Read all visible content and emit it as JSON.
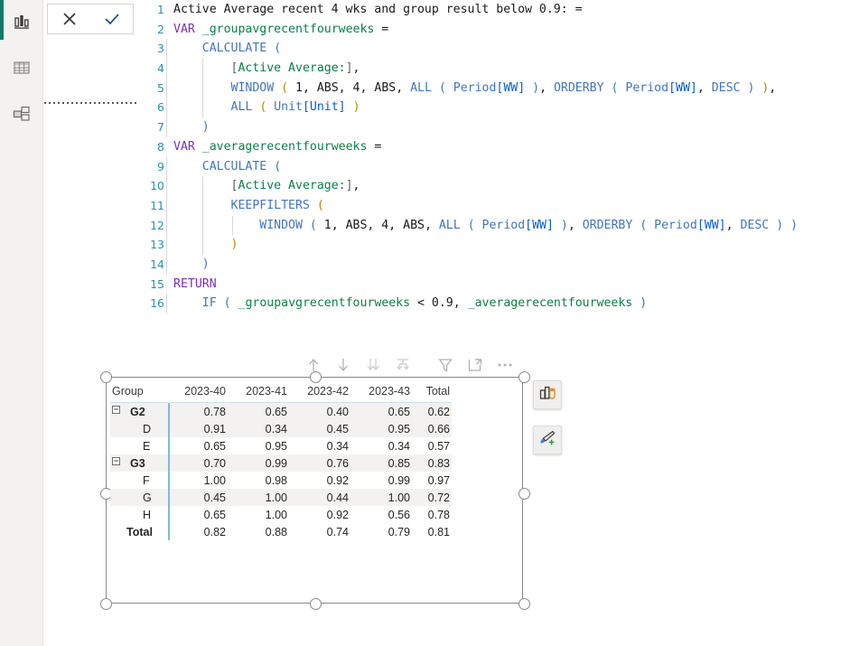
{
  "app": {
    "sidebar": {
      "items": [
        {
          "name": "report-view",
          "icon": "bar-chart-icon",
          "selected": true
        },
        {
          "name": "data-view",
          "icon": "table-grid-icon",
          "selected": false
        },
        {
          "name": "model-view",
          "icon": "relationships-icon",
          "selected": false
        }
      ],
      "accent_color": "#0f7a6b"
    },
    "formula_bar": {
      "cancel_label": "✕",
      "commit_label": "✓",
      "cancel_name": "cancel-edit-button",
      "commit_name": "commit-edit-button"
    }
  },
  "editor": {
    "language": "DAX",
    "line_count": 16,
    "lines": [
      {
        "n": "1",
        "indent": 0,
        "tokens": [
          {
            "t": "Active Average recent 4 wks and group result below 0.9: =",
            "c": "t-plain"
          }
        ]
      },
      {
        "n": "2",
        "indent": 0,
        "tokens": [
          {
            "t": "VAR",
            "c": "t-kw"
          },
          {
            "t": " ",
            "c": "t-plain"
          },
          {
            "t": "_groupavgrecentfourweeks",
            "c": "t-var"
          },
          {
            "t": " =",
            "c": "t-plain"
          }
        ]
      },
      {
        "n": "3",
        "indent": 1,
        "tokens": [
          {
            "t": "    ",
            "c": "t-plain"
          },
          {
            "t": "CALCULATE",
            "c": "t-fn"
          },
          {
            "t": " ",
            "c": "t-plain"
          },
          {
            "t": "(",
            "c": "t-par"
          }
        ]
      },
      {
        "n": "4",
        "indent": 2,
        "tokens": [
          {
            "t": "        ",
            "c": "t-plain"
          },
          {
            "t": "[",
            "c": "t-meas"
          },
          {
            "t": "Active Average:",
            "c": "t-measn"
          },
          {
            "t": "]",
            "c": "t-meas"
          },
          {
            "t": ",",
            "c": "t-plain"
          }
        ]
      },
      {
        "n": "5",
        "indent": 2,
        "tokens": [
          {
            "t": "        ",
            "c": "t-plain"
          },
          {
            "t": "WINDOW",
            "c": "t-fn"
          },
          {
            "t": " ",
            "c": "t-plain"
          },
          {
            "t": "(",
            "c": "t-par2"
          },
          {
            "t": " 1, ",
            "c": "t-num"
          },
          {
            "t": "ABS",
            "c": "t-num"
          },
          {
            "t": ", 4, ",
            "c": "t-num"
          },
          {
            "t": "ABS",
            "c": "t-num"
          },
          {
            "t": ", ",
            "c": "t-num"
          },
          {
            "t": "ALL",
            "c": "t-fn"
          },
          {
            "t": " ",
            "c": "t-plain"
          },
          {
            "t": "(",
            "c": "t-par"
          },
          {
            "t": " ",
            "c": "t-plain"
          },
          {
            "t": "Period",
            "c": "t-tbl"
          },
          {
            "t": "[WW]",
            "c": "t-col"
          },
          {
            "t": " ",
            "c": "t-plain"
          },
          {
            "t": ")",
            "c": "t-par"
          },
          {
            "t": ", ",
            "c": "t-plain"
          },
          {
            "t": "ORDERBY",
            "c": "t-fn"
          },
          {
            "t": " ",
            "c": "t-plain"
          },
          {
            "t": "(",
            "c": "t-par"
          },
          {
            "t": " ",
            "c": "t-plain"
          },
          {
            "t": "Period",
            "c": "t-tbl"
          },
          {
            "t": "[WW]",
            "c": "t-col"
          },
          {
            "t": ", ",
            "c": "t-plain"
          },
          {
            "t": "DESC",
            "c": "t-fn"
          },
          {
            "t": " ",
            "c": "t-plain"
          },
          {
            "t": ")",
            "c": "t-par"
          },
          {
            "t": " ",
            "c": "t-plain"
          },
          {
            "t": ")",
            "c": "t-par2"
          },
          {
            "t": ",",
            "c": "t-plain"
          }
        ]
      },
      {
        "n": "6",
        "indent": 2,
        "tokens": [
          {
            "t": "        ",
            "c": "t-plain"
          },
          {
            "t": "ALL",
            "c": "t-fn"
          },
          {
            "t": " ",
            "c": "t-plain"
          },
          {
            "t": "(",
            "c": "t-par2"
          },
          {
            "t": " ",
            "c": "t-plain"
          },
          {
            "t": "Unit",
            "c": "t-tbl"
          },
          {
            "t": "[Unit]",
            "c": "t-col"
          },
          {
            "t": " ",
            "c": "t-plain"
          },
          {
            "t": ")",
            "c": "t-par2"
          }
        ]
      },
      {
        "n": "7",
        "indent": 1,
        "tokens": [
          {
            "t": "    ",
            "c": "t-plain"
          },
          {
            "t": ")",
            "c": "t-par"
          }
        ]
      },
      {
        "n": "8",
        "indent": 0,
        "tokens": [
          {
            "t": "VAR",
            "c": "t-kw"
          },
          {
            "t": " ",
            "c": "t-plain"
          },
          {
            "t": "_averagerecentfourweeks",
            "c": "t-var"
          },
          {
            "t": " =",
            "c": "t-plain"
          }
        ]
      },
      {
        "n": "9",
        "indent": 1,
        "tokens": [
          {
            "t": "    ",
            "c": "t-plain"
          },
          {
            "t": "CALCULATE",
            "c": "t-fn"
          },
          {
            "t": " ",
            "c": "t-plain"
          },
          {
            "t": "(",
            "c": "t-par"
          }
        ]
      },
      {
        "n": "10",
        "indent": 2,
        "tokens": [
          {
            "t": "        ",
            "c": "t-plain"
          },
          {
            "t": "[",
            "c": "t-meas"
          },
          {
            "t": "Active Average:",
            "c": "t-measn"
          },
          {
            "t": "]",
            "c": "t-meas"
          },
          {
            "t": ",",
            "c": "t-plain"
          }
        ]
      },
      {
        "n": "11",
        "indent": 2,
        "tokens": [
          {
            "t": "        ",
            "c": "t-plain"
          },
          {
            "t": "KEEPFILTERS",
            "c": "t-fn"
          },
          {
            "t": " ",
            "c": "t-plain"
          },
          {
            "t": "(",
            "c": "t-par2"
          }
        ]
      },
      {
        "n": "12",
        "indent": 3,
        "tokens": [
          {
            "t": "            ",
            "c": "t-plain"
          },
          {
            "t": "WINDOW",
            "c": "t-fn"
          },
          {
            "t": " ",
            "c": "t-plain"
          },
          {
            "t": "(",
            "c": "t-par"
          },
          {
            "t": " 1, ",
            "c": "t-num"
          },
          {
            "t": "ABS",
            "c": "t-num"
          },
          {
            "t": ", 4, ",
            "c": "t-num"
          },
          {
            "t": "ABS",
            "c": "t-num"
          },
          {
            "t": ", ",
            "c": "t-num"
          },
          {
            "t": "ALL",
            "c": "t-fn"
          },
          {
            "t": " ",
            "c": "t-plain"
          },
          {
            "t": "(",
            "c": "t-par"
          },
          {
            "t": " ",
            "c": "t-plain"
          },
          {
            "t": "Period",
            "c": "t-tbl"
          },
          {
            "t": "[WW]",
            "c": "t-col"
          },
          {
            "t": " ",
            "c": "t-plain"
          },
          {
            "t": ")",
            "c": "t-par"
          },
          {
            "t": ", ",
            "c": "t-plain"
          },
          {
            "t": "ORDERBY",
            "c": "t-fn"
          },
          {
            "t": " ",
            "c": "t-plain"
          },
          {
            "t": "(",
            "c": "t-par"
          },
          {
            "t": " ",
            "c": "t-plain"
          },
          {
            "t": "Period",
            "c": "t-tbl"
          },
          {
            "t": "[WW]",
            "c": "t-col"
          },
          {
            "t": ", ",
            "c": "t-plain"
          },
          {
            "t": "DESC",
            "c": "t-fn"
          },
          {
            "t": " ",
            "c": "t-plain"
          },
          {
            "t": ")",
            "c": "t-par"
          },
          {
            "t": " ",
            "c": "t-plain"
          },
          {
            "t": ")",
            "c": "t-par"
          }
        ]
      },
      {
        "n": "13",
        "indent": 2,
        "tokens": [
          {
            "t": "        ",
            "c": "t-plain"
          },
          {
            "t": ")",
            "c": "t-par2"
          }
        ]
      },
      {
        "n": "14",
        "indent": 1,
        "tokens": [
          {
            "t": "    ",
            "c": "t-plain"
          },
          {
            "t": ")",
            "c": "t-par"
          }
        ]
      },
      {
        "n": "15",
        "indent": 0,
        "tokens": [
          {
            "t": "RETURN",
            "c": "t-kw"
          }
        ]
      },
      {
        "n": "16",
        "indent": 1,
        "tokens": [
          {
            "t": "    ",
            "c": "t-plain"
          },
          {
            "t": "IF",
            "c": "t-fn"
          },
          {
            "t": " ",
            "c": "t-plain"
          },
          {
            "t": "(",
            "c": "t-par"
          },
          {
            "t": " ",
            "c": "t-plain"
          },
          {
            "t": "_groupavgrecentfourweeks",
            "c": "t-var"
          },
          {
            "t": " < ",
            "c": "t-op"
          },
          {
            "t": "0.9",
            "c": "t-num"
          },
          {
            "t": ", ",
            "c": "t-plain"
          },
          {
            "t": "_averagerecentfourweeks",
            "c": "t-var"
          },
          {
            "t": " ",
            "c": "t-plain"
          },
          {
            "t": ")",
            "c": "t-par"
          }
        ]
      }
    ]
  },
  "visual_toolbar": {
    "buttons": [
      {
        "name": "drill-up-icon",
        "title": "Drill up"
      },
      {
        "name": "drill-down-arrow-icon",
        "title": "Go to the next level in the hierarchy"
      },
      {
        "name": "expand-all-down-icon",
        "title": "Expand all down one level in the hierarchy"
      },
      {
        "name": "drill-mode-icon",
        "title": "Drill on"
      },
      {
        "name": "filter-icon",
        "title": "Filters"
      },
      {
        "name": "focus-mode-icon",
        "title": "Focus mode"
      },
      {
        "name": "more-options-icon",
        "title": "More options"
      }
    ]
  },
  "floating_buttons": [
    {
      "name": "visualizations-pane-button",
      "icon": "visual-type-icon"
    },
    {
      "name": "format-pane-button",
      "icon": "paintbrush-plus-icon"
    }
  ],
  "matrix": {
    "columns": [
      "Group",
      "2023-40",
      "2023-41",
      "2023-42",
      "2023-43",
      "Total"
    ],
    "rows": [
      {
        "level": 0,
        "expander": "−",
        "label": "G2",
        "values": [
          "0.78",
          "0.65",
          "0.40",
          "0.65"
        ],
        "total": "0.62",
        "alt": true
      },
      {
        "level": 1,
        "expander": "",
        "label": "D",
        "values": [
          "0.91",
          "0.34",
          "0.45",
          "0.95"
        ],
        "total": "0.66",
        "alt": true
      },
      {
        "level": 1,
        "expander": "",
        "label": "E",
        "values": [
          "0.65",
          "0.95",
          "0.34",
          "0.34"
        ],
        "total": "0.57",
        "alt": false
      },
      {
        "level": 0,
        "expander": "−",
        "label": "G3",
        "values": [
          "0.70",
          "0.99",
          "0.76",
          "0.85"
        ],
        "total": "0.83",
        "alt": true
      },
      {
        "level": 1,
        "expander": "",
        "label": "F",
        "values": [
          "1.00",
          "0.98",
          "0.92",
          "0.99"
        ],
        "total": "0.97",
        "alt": false
      },
      {
        "level": 1,
        "expander": "",
        "label": "G",
        "values": [
          "0.45",
          "1.00",
          "0.44",
          "1.00"
        ],
        "total": "0.72",
        "alt": true
      },
      {
        "level": 1,
        "expander": "",
        "label": "H",
        "values": [
          "0.65",
          "1.00",
          "0.92",
          "0.56"
        ],
        "total": "0.78",
        "alt": false
      },
      {
        "level": 2,
        "expander": "",
        "label": "Total",
        "values": [
          "0.82",
          "0.88",
          "0.74",
          "0.79"
        ],
        "total": "0.81",
        "alt": false
      }
    ]
  },
  "colors": {
    "accent_teal": "#0f7a6b",
    "column_divider": "#7fb8e8",
    "header_rule": "#c6e0f5",
    "alt_row": "#f3f2f1",
    "selection_border": "#8a8886",
    "keyword": "#7b2fbe",
    "variable": "#0b8047",
    "function": "#4175c2",
    "column_ref": "#0b5cd5"
  }
}
